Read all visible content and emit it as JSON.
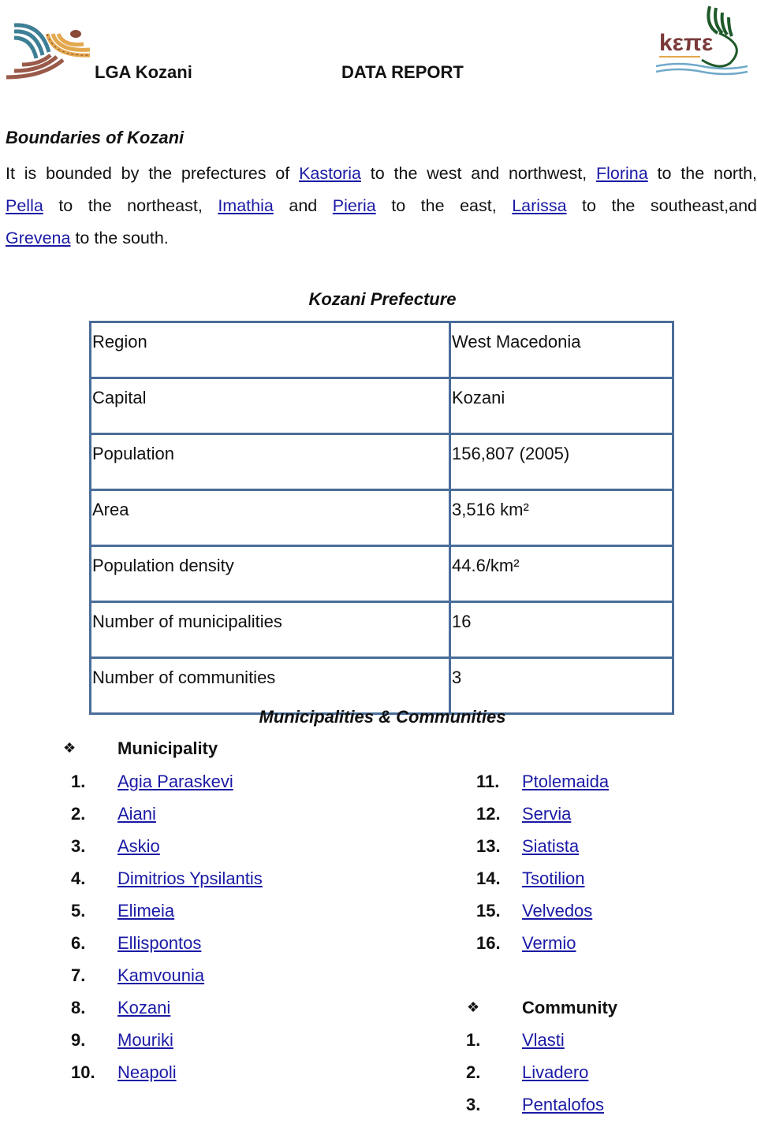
{
  "header": {
    "left_logo": "lga-logo",
    "title": "LGA Kozani",
    "report_label": "DATA REPORT",
    "right_logo": "kepe-logo",
    "right_logo_text": "kεπε"
  },
  "boundaries": {
    "heading": "Boundaries of Kozani",
    "lines": [
      [
        {
          "t": "It is bounded by the prefectures of "
        },
        {
          "t": "Kastoria",
          "link": true
        },
        {
          "t": " to the west and northwest, "
        },
        {
          "t": "Florina",
          "link": true
        },
        {
          "t": " to the north,"
        }
      ],
      [
        {
          "t": "Pella",
          "link": true
        },
        {
          "t": " to the northeast, "
        },
        {
          "t": "Imathia",
          "link": true
        },
        {
          "t": " and "
        },
        {
          "t": "Pieria",
          "link": true
        },
        {
          "t": " to the east, "
        },
        {
          "t": "Larissa",
          "link": true
        },
        {
          "t": " to the southeast,and"
        }
      ],
      [
        {
          "t": "Grevena",
          "link": true
        },
        {
          "t": " to the south."
        }
      ]
    ]
  },
  "prefecture": {
    "caption": "Kozani Prefecture",
    "rows": [
      {
        "key": "Region",
        "value": "West Macedonia"
      },
      {
        "key": "Capital",
        "value": "Kozani"
      },
      {
        "key": "Population",
        "value": "156,807 (2005)"
      },
      {
        "key": "Area",
        "value": "3,516 km²"
      },
      {
        "key": "Population density",
        "value": "44.6/km²"
      },
      {
        "key": "Number of municipalities",
        "value": "16"
      },
      {
        "key": "Number of communities",
        "value": "3"
      }
    ]
  },
  "lists": {
    "caption": "Municipalities & Communities",
    "bullet_glyph": "❖",
    "municipality_heading": "Municipality",
    "municipalities": [
      {
        "num": "1.",
        "name": "Agia Paraskevi"
      },
      {
        "num": "2.",
        "name": "Aiani"
      },
      {
        "num": "3.",
        "name": "Askio"
      },
      {
        "num": "4.",
        "name": "Dimitrios Ypsilantis"
      },
      {
        "num": "5.",
        "name": "Elimeia"
      },
      {
        "num": "6.",
        "name": "Ellispontos"
      },
      {
        "num": "7.",
        "name": "Kamvounia"
      },
      {
        "num": "8.",
        "name": "Kozani"
      },
      {
        "num": "9.",
        "name": "Mouriki"
      },
      {
        "num": "10.",
        "name": "Neapoli"
      },
      {
        "num": "11.",
        "name": "Ptolemaida"
      },
      {
        "num": "12.",
        "name": "Servia"
      },
      {
        "num": "13.",
        "name": "Siatista"
      },
      {
        "num": "14.",
        "name": "Tsotilion"
      },
      {
        "num": "15.",
        "name": "Velvedos"
      },
      {
        "num": "16.",
        "name": "Vermio"
      }
    ],
    "community_heading": "Community",
    "communities": [
      {
        "num": "1.",
        "name": "Vlasti"
      },
      {
        "num": "2.",
        "name": "Livadero"
      },
      {
        "num": "3.",
        "name": "Pentalofos"
      }
    ]
  },
  "colors": {
    "link": "#1a1aa6",
    "table_border": "#4a6d99",
    "text": "#111111"
  }
}
